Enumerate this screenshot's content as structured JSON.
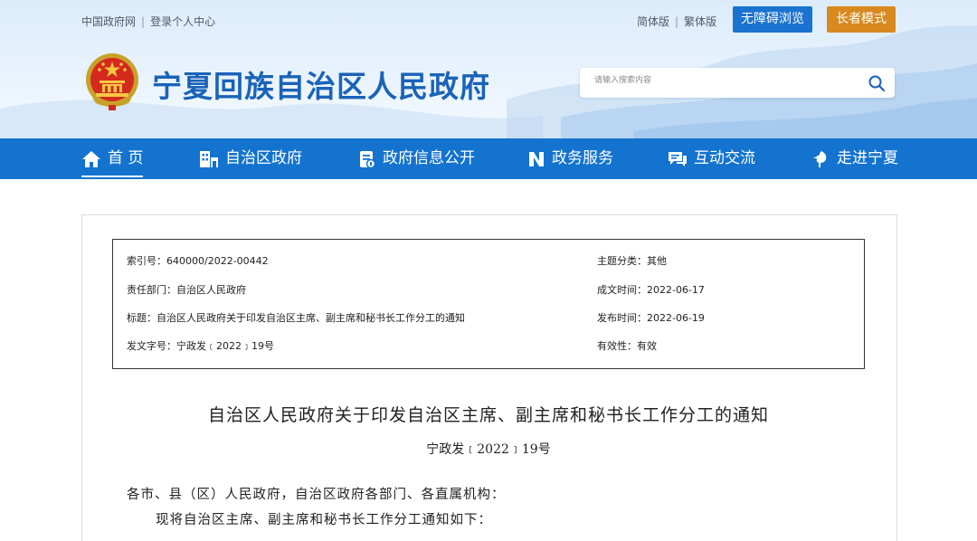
{
  "top_links": {
    "gov_net": "中国政府网",
    "login": "登录个人中心"
  },
  "lang": {
    "simplified": "简体版",
    "traditional": "繁体版"
  },
  "buttons": {
    "accessible": "无障碍浏览",
    "elder": "长者模式"
  },
  "site": {
    "title": "宁夏回族自治区人民政府"
  },
  "search": {
    "placeholder": "请输入搜索内容"
  },
  "nav": {
    "items": [
      {
        "label": "首 页",
        "icon": "home-icon"
      },
      {
        "label": "自治区政府",
        "icon": "building-icon"
      },
      {
        "label": "政府信息公开",
        "icon": "info-disclosure-icon"
      },
      {
        "label": "政务服务",
        "icon": "service-icon"
      },
      {
        "label": "互动交流",
        "icon": "chat-icon"
      },
      {
        "label": "走进宁夏",
        "icon": "leaf-icon"
      }
    ]
  },
  "meta": {
    "index_no": "索引号：640000/2022-00442",
    "department": "责任部门：自治区人民政府",
    "title": "标题：自治区人民政府关于印发自治区主席、副主席和秘书长工作分工的通知",
    "doc_no": "发文字号：宁政发﹝2022﹞19号",
    "category": "主题分类：其他",
    "written_date": "成文时间：2022-06-17",
    "publish_date": "发布时间：2022-06-19",
    "validity": "有效性：有效"
  },
  "document": {
    "title": "自治区人民政府关于印发自治区主席、副主席和秘书长工作分工的通知",
    "number": "宁政发﹝2022﹞19号",
    "salutation": "各市、县（区）人民政府，自治区政府各部门、各直属机构：",
    "body_first": "现将自治区主席、副主席和秘书长工作分工通知如下："
  },
  "colors": {
    "brand_blue": "#1373cf",
    "title_blue": "#1a63b8",
    "elder_orange": "#d8891f"
  }
}
